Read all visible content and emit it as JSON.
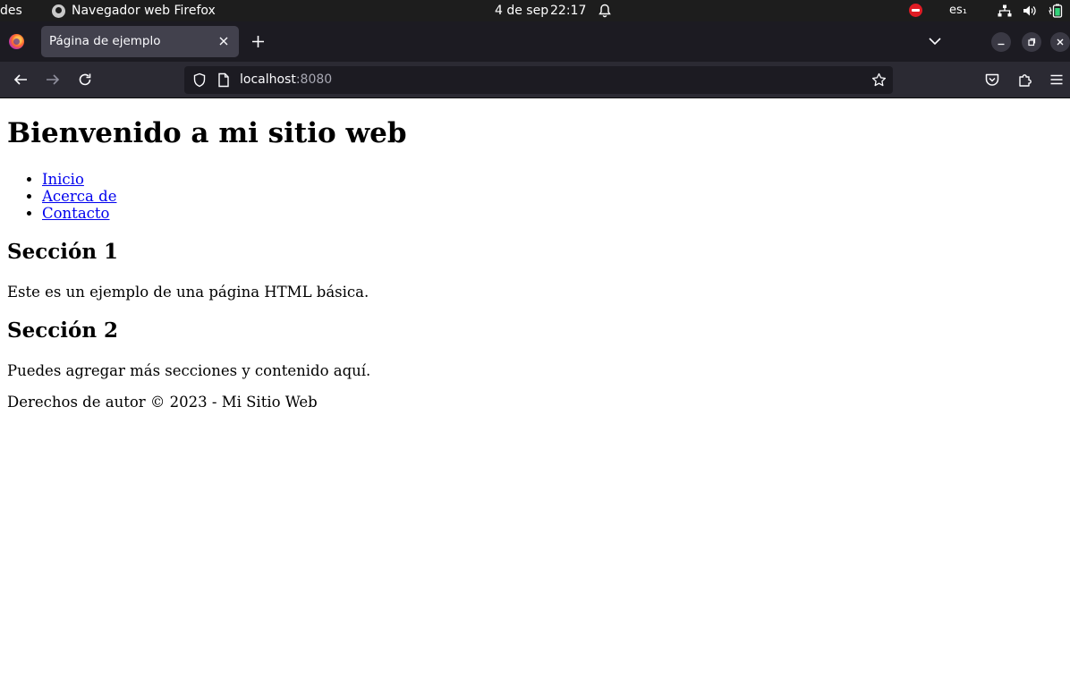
{
  "system_bar": {
    "activities_label": "des",
    "app_name": "Navegador web Firefox",
    "date": "4 de sep",
    "time": "22:17",
    "keyboard_layout": "es₁",
    "icons": [
      "firefox-icon",
      "bell-icon",
      "do-not-disturb-icon",
      "network-icon",
      "volume-icon",
      "battery-icon"
    ],
    "colors": {
      "background": "#1d1d1d",
      "dnd": "#e01b24"
    }
  },
  "browser": {
    "tab": {
      "title": "Página de ejemplo"
    },
    "url": {
      "host": "localhost",
      "port": ":8080"
    },
    "colors": {
      "tabstrip": "#1c1b22",
      "active_tab": "#42414d",
      "toolbar": "#2b2a33",
      "urlbar": "#1c1b22"
    },
    "icons": [
      "back-icon",
      "forward-icon",
      "reload-icon",
      "shield-icon",
      "page-icon",
      "star-icon",
      "pocket-icon",
      "extensions-icon",
      "menu-icon"
    ]
  },
  "page": {
    "title": "Bienvenido a mi sitio web",
    "nav_items": [
      {
        "label": "Inicio"
      },
      {
        "label": "Acerca de"
      },
      {
        "label": "Contacto"
      }
    ],
    "sections": [
      {
        "heading": "Sección 1",
        "text": "Este es un ejemplo de una página HTML básica."
      },
      {
        "heading": "Sección 2",
        "text": "Puedes agregar más secciones y contenido aquí."
      }
    ],
    "footer": "Derechos de autor © 2023 - Mi Sitio Web",
    "colors": {
      "link": "#0000ee",
      "text": "#000000"
    }
  }
}
